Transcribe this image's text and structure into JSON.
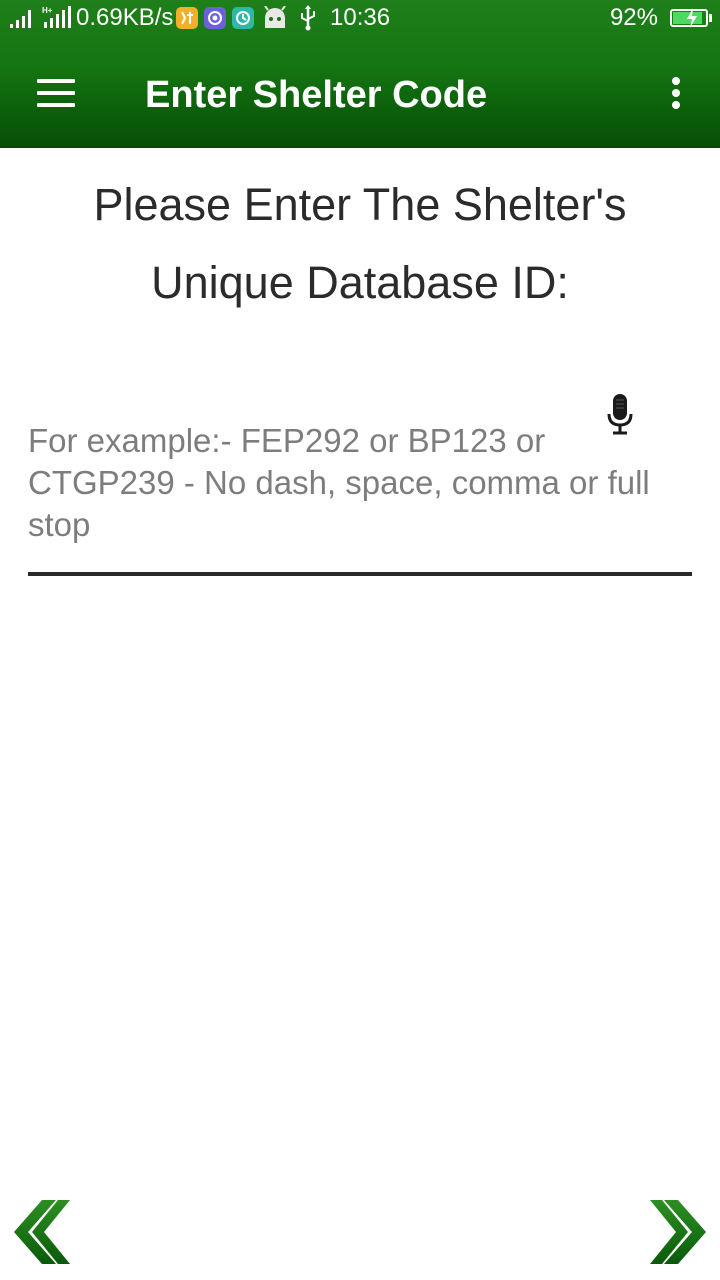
{
  "status_bar": {
    "network_speed": "0.69KB/s",
    "time": "10:36",
    "battery_percent": "92%",
    "battery_level": 0.92,
    "icons": [
      "signal-icon",
      "hplus-signal-icon",
      "app-notification-icon",
      "app-notification-icon",
      "app-notification-icon",
      "android-debug-icon",
      "usb-icon",
      "battery-charging-icon"
    ]
  },
  "toolbar": {
    "title": "Enter Shelter Code",
    "menu_icon": "hamburger-menu-icon",
    "overflow_icon": "more-vert-icon"
  },
  "main": {
    "heading": "Please Enter The Shelter's Unique Database ID:",
    "shelter_id_input": {
      "value": "",
      "placeholder": "For example:- FEP292 or BP123 or CTGP239 - No dash, space, comma or full stop"
    },
    "mic_icon": "microphone-icon"
  },
  "navigation": {
    "prev_icon": "double-chevron-left-icon",
    "next_icon": "double-chevron-right-icon"
  },
  "colors": {
    "appbar_green": "#157512",
    "arrow_green": "#0e6b10",
    "heading_text": "#2b2b2b",
    "placeholder_text": "#7d7d7d",
    "underline": "#2a2a2a"
  }
}
